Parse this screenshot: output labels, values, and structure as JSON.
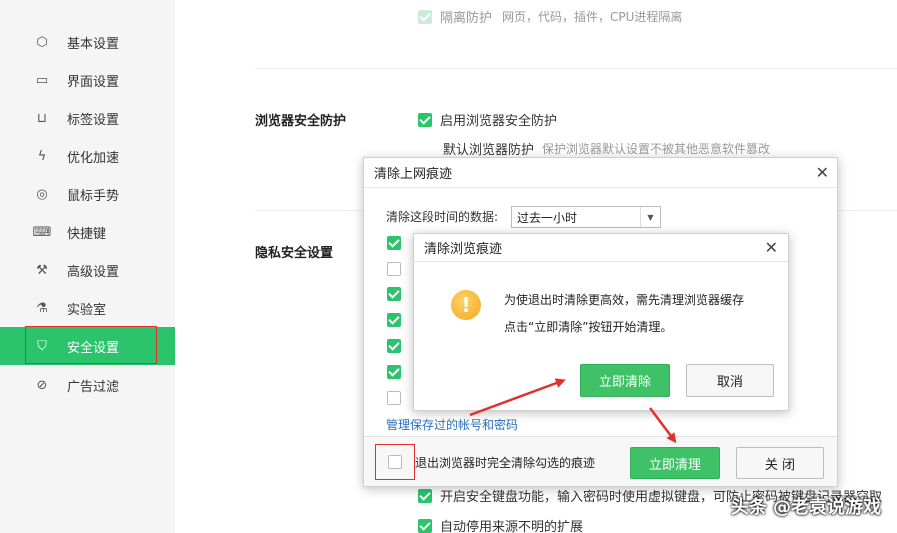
{
  "sidebar": {
    "items": [
      {
        "label": "基本设置",
        "icon": "hexagon-icon"
      },
      {
        "label": "界面设置",
        "icon": "window-icon"
      },
      {
        "label": "标签设置",
        "icon": "tab-icon"
      },
      {
        "label": "优化加速",
        "icon": "lightning-icon"
      },
      {
        "label": "鼠标手势",
        "icon": "mouse-icon"
      },
      {
        "label": "快捷键",
        "icon": "keyboard-icon"
      },
      {
        "label": "高级设置",
        "icon": "wrench-icon"
      },
      {
        "label": "实验室",
        "icon": "flask-icon"
      },
      {
        "label": "安全设置",
        "icon": "shield-icon",
        "active": true
      },
      {
        "label": "广告过滤",
        "icon": "block-icon"
      }
    ]
  },
  "main": {
    "isolation": {
      "label": "隔离防护",
      "desc": "网页，代码，插件，CPU进程隔离"
    },
    "browser_security": {
      "title": "浏览器安全防护",
      "enable_label": "启用浏览器安全防护",
      "default_label": "默认浏览器防护",
      "default_desc": "保护浏览器默认设置不被其他恶意软件篡改"
    },
    "privacy": {
      "title": "隐私安全设置",
      "keyboard_label": "开启安全键盘功能，输入密码时使用虚拟键盘，可防止密码被键盘记录器窃取",
      "extension_label": "自动停用来源不明的扩展"
    }
  },
  "clear_dialog": {
    "title": "清除上网痕迹",
    "range_label": "清除这段时间的数据:",
    "range_value": "过去一小时",
    "checkbox_states": [
      true,
      false,
      true,
      true,
      true,
      true,
      false
    ],
    "manage_link": "管理保存过的帐号和密码",
    "exit_clear_label": "退出浏览器时完全清除勾选的痕迹",
    "clear_button": "立即清理",
    "close_button": "关 闭"
  },
  "alert_dialog": {
    "title": "清除浏览痕迹",
    "message_line1": "为使退出时清除更高效，需先清理浏览器缓存",
    "message_line2": "点击“立即清除”按钮开始清理。",
    "confirm_button": "立即清除",
    "cancel_button": "取消"
  },
  "watermark": "头条 @老袁说游戏",
  "colors": {
    "accent": "#2bc46c",
    "highlight": "#e0322b",
    "link": "#2a6ebb"
  }
}
